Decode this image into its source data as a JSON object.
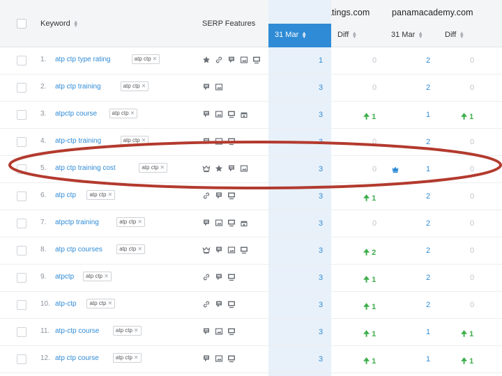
{
  "header": {
    "keyword_label": "Keyword",
    "serp_label": "SERP Features",
    "domain1": "aerostartyperatings.com",
    "domain2": "panamacademy.com",
    "date1": "31 Mar",
    "diff1": "Diff",
    "date2": "31 Mar",
    "diff2": "Diff"
  },
  "rows": [
    {
      "num": "1.",
      "keyword": "atp ctp type rating",
      "tag": "atp ctp",
      "features": [
        "star-icon",
        "link-icon",
        "snippet-icon",
        "image-icon",
        "video-icon"
      ],
      "pos1": "1",
      "diff1": "0",
      "pos2": "2",
      "diff2": "0"
    },
    {
      "num": "2.",
      "keyword": "atp ctp training",
      "tag": "atp ctp",
      "features": [
        "snippet-icon",
        "image-icon"
      ],
      "pos1": "3",
      "diff1": "0",
      "pos2": "2",
      "diff2": "0"
    },
    {
      "num": "3.",
      "keyword": "atpctp course",
      "tag": "atp ctp",
      "features": [
        "snippet-icon",
        "image-icon",
        "video-icon",
        "shop-icon"
      ],
      "pos1": "3",
      "diff1": "1",
      "pos2": "1",
      "diff2": "1"
    },
    {
      "num": "4.",
      "keyword": "atp-ctp training",
      "tag": "atp ctp",
      "features": [
        "snippet-icon",
        "image-icon",
        "video-icon"
      ],
      "pos1": "3",
      "diff1": "0",
      "pos2": "2",
      "diff2": "0"
    },
    {
      "num": "5.",
      "keyword": "atp ctp training cost",
      "tag": "atp ctp",
      "features": [
        "crown-icon",
        "star-icon",
        "snippet-icon",
        "image-icon"
      ],
      "pos1": "3",
      "diff1": "0",
      "pos2": "1",
      "diff2": "0"
    },
    {
      "num": "6.",
      "keyword": "atp ctp",
      "tag": "atp ctp",
      "features": [
        "link-icon",
        "snippet-icon",
        "video-icon"
      ],
      "pos1": "3",
      "diff1": "1",
      "pos2": "2",
      "diff2": "0"
    },
    {
      "num": "7.",
      "keyword": "atpctp training",
      "tag": "atp ctp",
      "features": [
        "snippet-icon",
        "image-icon",
        "video-icon",
        "shop-icon"
      ],
      "pos1": "3",
      "diff1": "0",
      "pos2": "2",
      "diff2": "0"
    },
    {
      "num": "8.",
      "keyword": "atp ctp courses",
      "tag": "atp ctp",
      "features": [
        "crown-icon",
        "snippet-icon",
        "image-icon",
        "video-icon"
      ],
      "pos1": "3",
      "diff1": "2",
      "pos2": "2",
      "diff2": "0"
    },
    {
      "num": "9.",
      "keyword": "atpctp",
      "tag": "atp ctp",
      "features": [
        "link-icon",
        "snippet-icon",
        "video-icon"
      ],
      "pos1": "3",
      "diff1": "1",
      "pos2": "2",
      "diff2": "0"
    },
    {
      "num": "10.",
      "keyword": "atp-ctp",
      "tag": "atp ctp",
      "features": [
        "link-icon",
        "snippet-icon",
        "video-icon"
      ],
      "pos1": "3",
      "diff1": "1",
      "pos2": "2",
      "diff2": "0"
    },
    {
      "num": "11.",
      "keyword": "atp-ctp course",
      "tag": "atp ctp",
      "features": [
        "snippet-icon",
        "image-icon",
        "video-icon"
      ],
      "pos1": "3",
      "diff1": "1",
      "pos2": "1",
      "diff2": "1"
    },
    {
      "num": "12.",
      "keyword": "atp ctp course",
      "tag": "atp ctp",
      "features": [
        "snippet-icon",
        "image-icon",
        "video-icon"
      ],
      "pos1": "3",
      "diff1": "1",
      "pos2": "1",
      "diff2": "1"
    }
  ],
  "colors": {
    "accent": "#2f8bd6",
    "up": "#3dae4b",
    "highlight_oval": "#b33a2e"
  }
}
